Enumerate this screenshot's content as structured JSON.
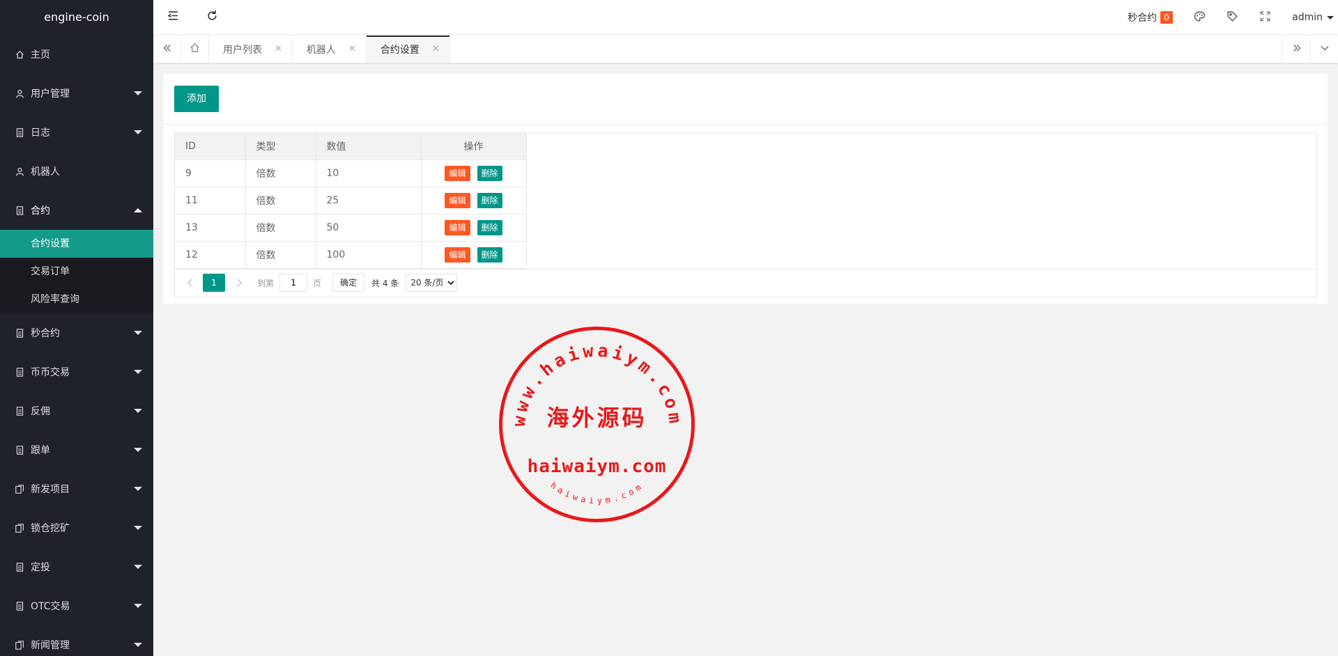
{
  "app": {
    "name": "engine-coin"
  },
  "sidebar": {
    "items": [
      {
        "label": "主页",
        "icon": "home-icon"
      },
      {
        "label": "用户管理",
        "icon": "user-icon"
      },
      {
        "label": "日志",
        "icon": "doc-icon"
      },
      {
        "label": "机器人",
        "icon": "user-icon"
      },
      {
        "label": "合约",
        "icon": "doc-icon"
      },
      {
        "label": "秒合约",
        "icon": "doc-icon"
      },
      {
        "label": "币币交易",
        "icon": "doc-icon"
      },
      {
        "label": "反佣",
        "icon": "doc-icon"
      },
      {
        "label": "跟单",
        "icon": "doc-icon"
      },
      {
        "label": "新发项目",
        "icon": "docs-icon"
      },
      {
        "label": "锁仓挖矿",
        "icon": "docs-icon"
      },
      {
        "label": "定投",
        "icon": "doc-icon"
      },
      {
        "label": "OTC交易",
        "icon": "doc-icon"
      },
      {
        "label": "新闻管理",
        "icon": "docs-icon"
      }
    ],
    "contract_submenu": [
      {
        "label": "合约设置"
      },
      {
        "label": "交易订单"
      },
      {
        "label": "风险率查询"
      }
    ]
  },
  "header": {
    "notice_label": "秒合约",
    "notice_count": "0",
    "user": "admin"
  },
  "tabs": [
    {
      "label": "用户列表"
    },
    {
      "label": "机器人"
    },
    {
      "label": "合约设置"
    }
  ],
  "toolbar": {
    "add_label": "添加"
  },
  "table": {
    "headers": [
      "ID",
      "类型",
      "数值",
      "操作"
    ],
    "rows": [
      {
        "id": "9",
        "type": "倍数",
        "value": "10"
      },
      {
        "id": "11",
        "type": "倍数",
        "value": "25"
      },
      {
        "id": "13",
        "type": "倍数",
        "value": "50"
      },
      {
        "id": "12",
        "type": "倍数",
        "value": "100"
      }
    ],
    "edit_label": "编辑",
    "delete_label": "删除"
  },
  "pager": {
    "current": "1",
    "goto_label": "到第",
    "goto_value": "1",
    "page_label": "页",
    "confirm_label": "确定",
    "total": "共 4 条",
    "page_size": "20 条/页"
  },
  "watermark": {
    "arc_top": "www.haiwaiym.com",
    "center": "海外源码",
    "domain": "haiwaiym.com",
    "arc_bottom": "haiwaiym.com",
    "color": "#e8191b"
  }
}
